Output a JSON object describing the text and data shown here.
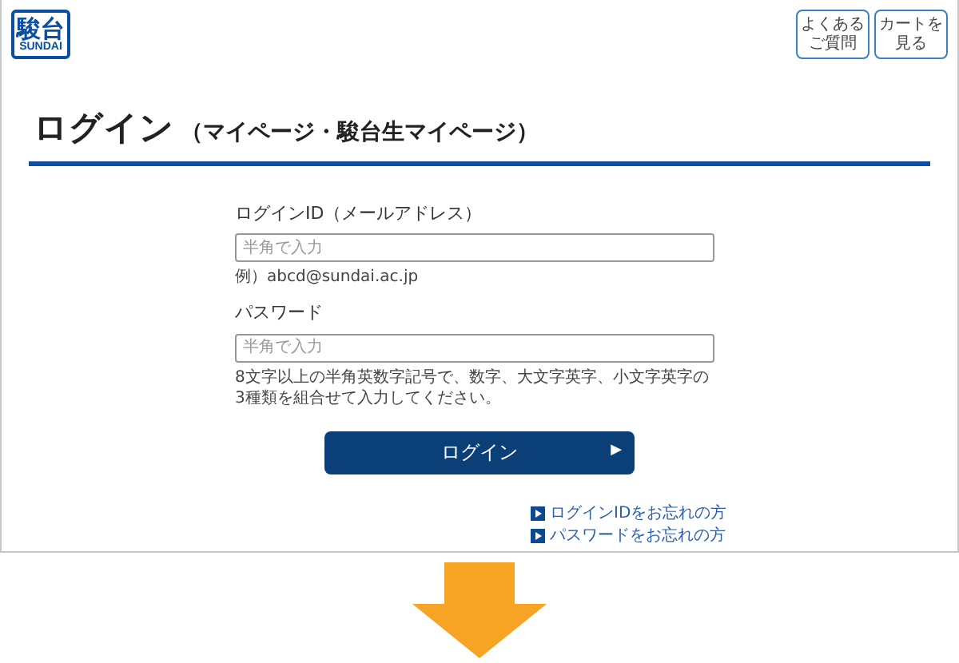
{
  "header": {
    "logo": {
      "kanji": "駿台",
      "latin": "SUNDAI"
    },
    "buttons": [
      {
        "lines": [
          "よくある",
          "ご質問"
        ]
      },
      {
        "lines": [
          "カートを",
          "見る"
        ]
      }
    ]
  },
  "page": {
    "title": "ログイン",
    "subtitle": "（マイページ・駿台生マイページ）"
  },
  "form": {
    "fields": [
      {
        "label": "ログインID（メールアドレス）",
        "placeholder": "半角で入力",
        "note": "例）abcd@sundai.ac.jp"
      },
      {
        "label": "パスワード",
        "placeholder": "半角で入力",
        "note": "8文字以上の半角英数字記号で、数字、大文字英字、小文字英字の3種類を組合せて入力してください。"
      }
    ],
    "submit": {
      "label": "ログイン",
      "arrow": "▶"
    },
    "links": [
      {
        "label": "ログインIDをお忘れの方"
      },
      {
        "label": "パスワードをお忘れの方"
      }
    ]
  }
}
